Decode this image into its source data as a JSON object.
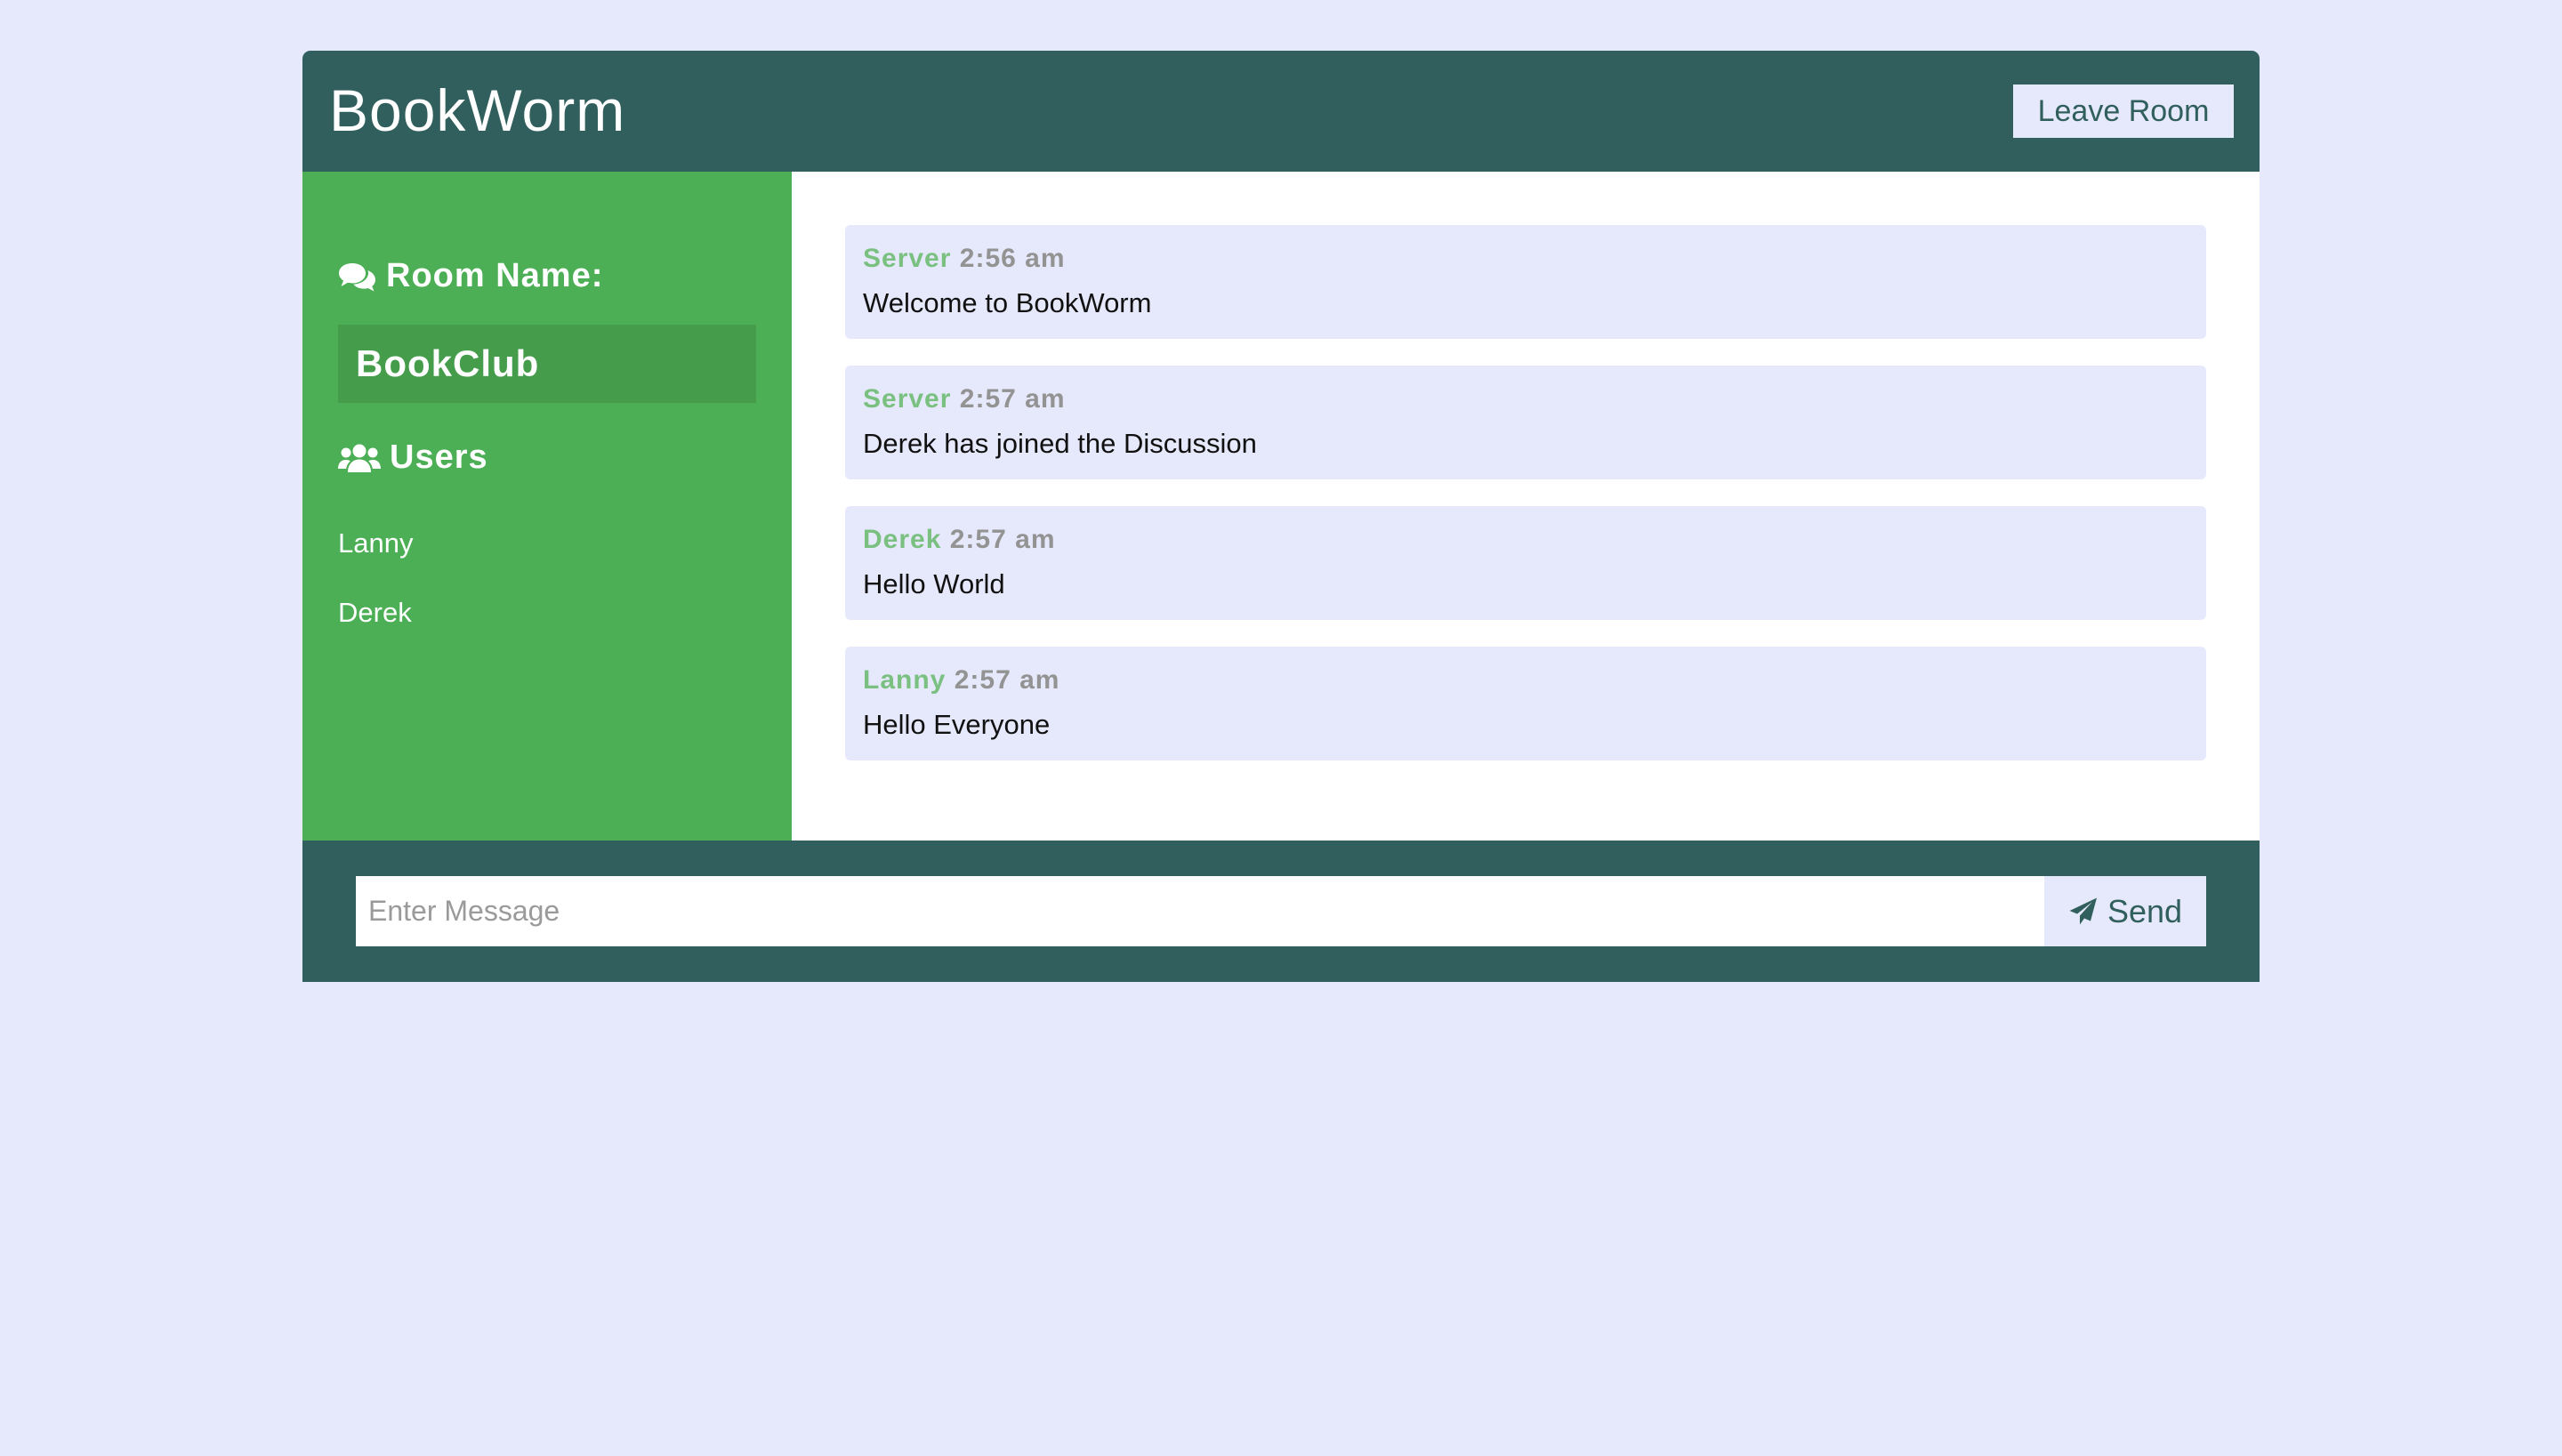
{
  "app": {
    "title": "BookWorm",
    "leave_label": "Leave Room"
  },
  "sidebar": {
    "room_heading": "Room Name:",
    "room_heading_icon": "comments-icon",
    "room_name": "BookClub",
    "users_heading": "Users",
    "users_heading_icon": "users-icon",
    "users": [
      "Lanny",
      "Derek"
    ]
  },
  "messages": [
    {
      "user": "Server",
      "time": "2:56 am",
      "text": "Welcome to BookWorm"
    },
    {
      "user": "Server",
      "time": "2:57 am",
      "text": "Derek has joined the Discussion"
    },
    {
      "user": "Derek",
      "time": "2:57 am",
      "text": "Hello World"
    },
    {
      "user": "Lanny",
      "time": "2:57 am",
      "text": "Hello Everyone"
    }
  ],
  "composer": {
    "value": "",
    "placeholder": "Enter Message",
    "send_label": "Send",
    "send_icon": "paper-plane-icon"
  },
  "colors": {
    "page_background": "#e6e9fb",
    "header": "#315f5d",
    "sidebar": "#4caf55",
    "room_name_box": "#459c4b",
    "message_user": "#7ac081",
    "message_time": "#939393"
  }
}
